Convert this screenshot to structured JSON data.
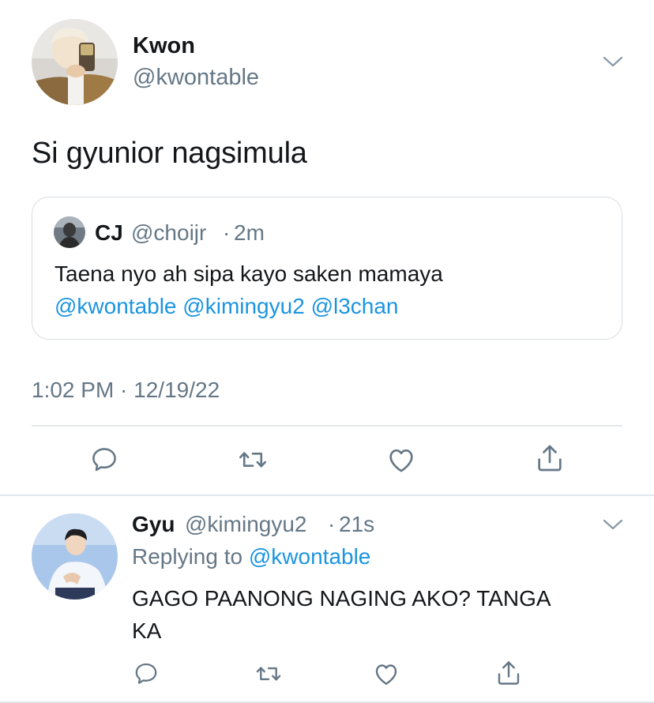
{
  "main_tweet": {
    "author_name": "Kwon",
    "author_handle": "@kwontable",
    "text": "Si gyunior nagsimula",
    "timestamp": "1:02 PM · 12/19/22",
    "quoted": {
      "author_name": "CJ",
      "author_handle": "@choijr",
      "separator": "·",
      "age": "2m",
      "text_line1": "Taena nyo ah sipa kayo saken mamaya",
      "mentions": [
        "@kwontable",
        "@kimingyu2",
        "@l3chan"
      ]
    }
  },
  "actions": {
    "icons": [
      "reply-icon",
      "retweet-icon",
      "like-icon",
      "share-icon"
    ]
  },
  "reply_tweet": {
    "author_name": "Gyu",
    "author_handle": "@kimingyu2",
    "separator": "·",
    "age": "21s",
    "replying_prefix": "Replying to",
    "replying_to": "@kwontable",
    "text_line1": "GAGO PAANONG NAGING AKO? TANGA",
    "text_line2": "KA"
  },
  "colors": {
    "text": "#14171a",
    "secondary": "#657786",
    "link": "#1b95e0",
    "border": "#e1e8ed"
  }
}
